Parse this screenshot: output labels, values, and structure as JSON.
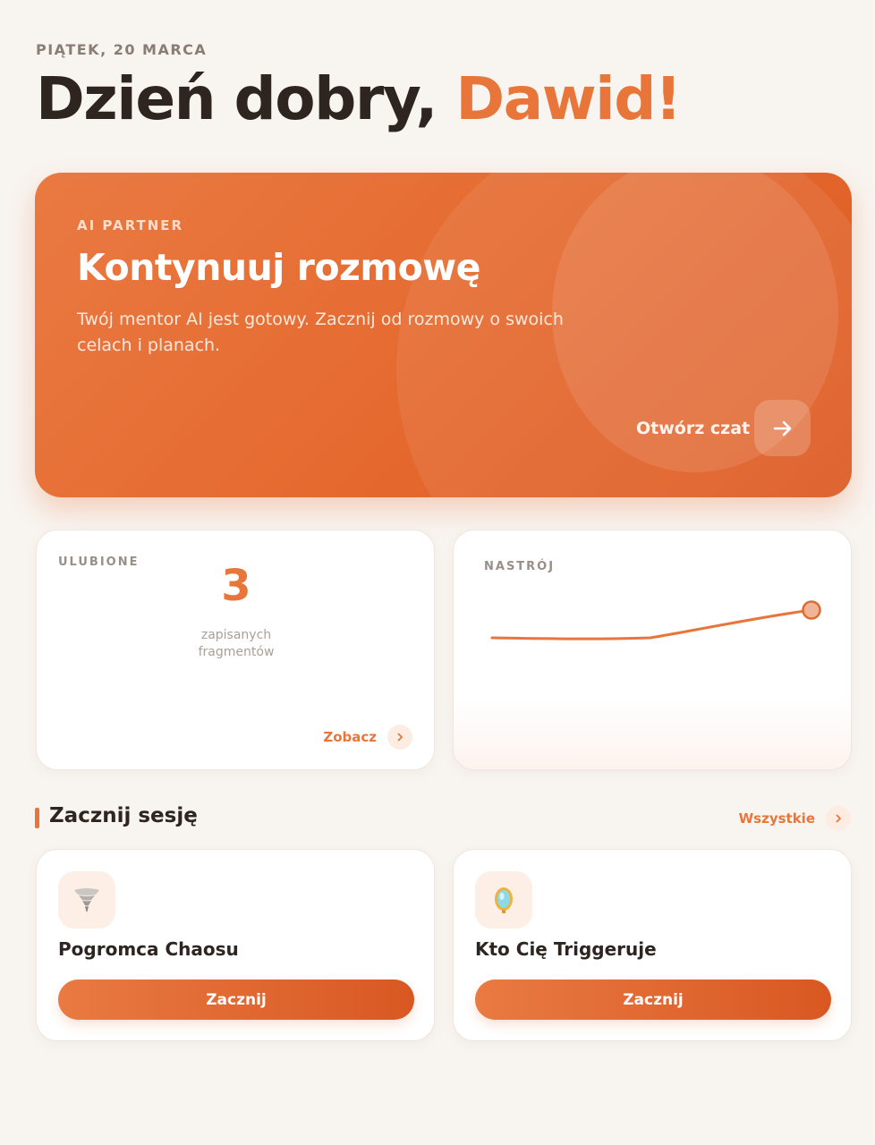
{
  "header": {
    "date": "PIĄTEK, 20 MARCA",
    "greeting": "Dzień dobry,",
    "name": "Dawid!"
  },
  "hero": {
    "label": "AI PARTNER",
    "title": "Kontynuuj rozmowę",
    "description": "Twój mentor AI jest gotowy. Zacznij od rozmowy o swoich celach i planach.",
    "cta": "Otwórz czat",
    "arrow_icon": "arrow-right-icon"
  },
  "favorites": {
    "label": "ULUBIONE",
    "count": "3",
    "subtitle": "zapisanych fragmentów",
    "link": "Zobacz"
  },
  "mood": {
    "label": "NASTRÓJ"
  },
  "sessions": {
    "title": "Zacznij sesję",
    "all_link": "Wszystkie",
    "items": [
      {
        "title": "Pogromca Chaosu",
        "icon": "tornado-icon",
        "button": "Zacznij"
      },
      {
        "title": "Kto Cię Triggeruje",
        "icon": "mirror-icon",
        "button": "Zacznij"
      }
    ]
  },
  "colors": {
    "accent": "#e8763a",
    "background": "#f8f4f0",
    "text": "#2e2521"
  }
}
